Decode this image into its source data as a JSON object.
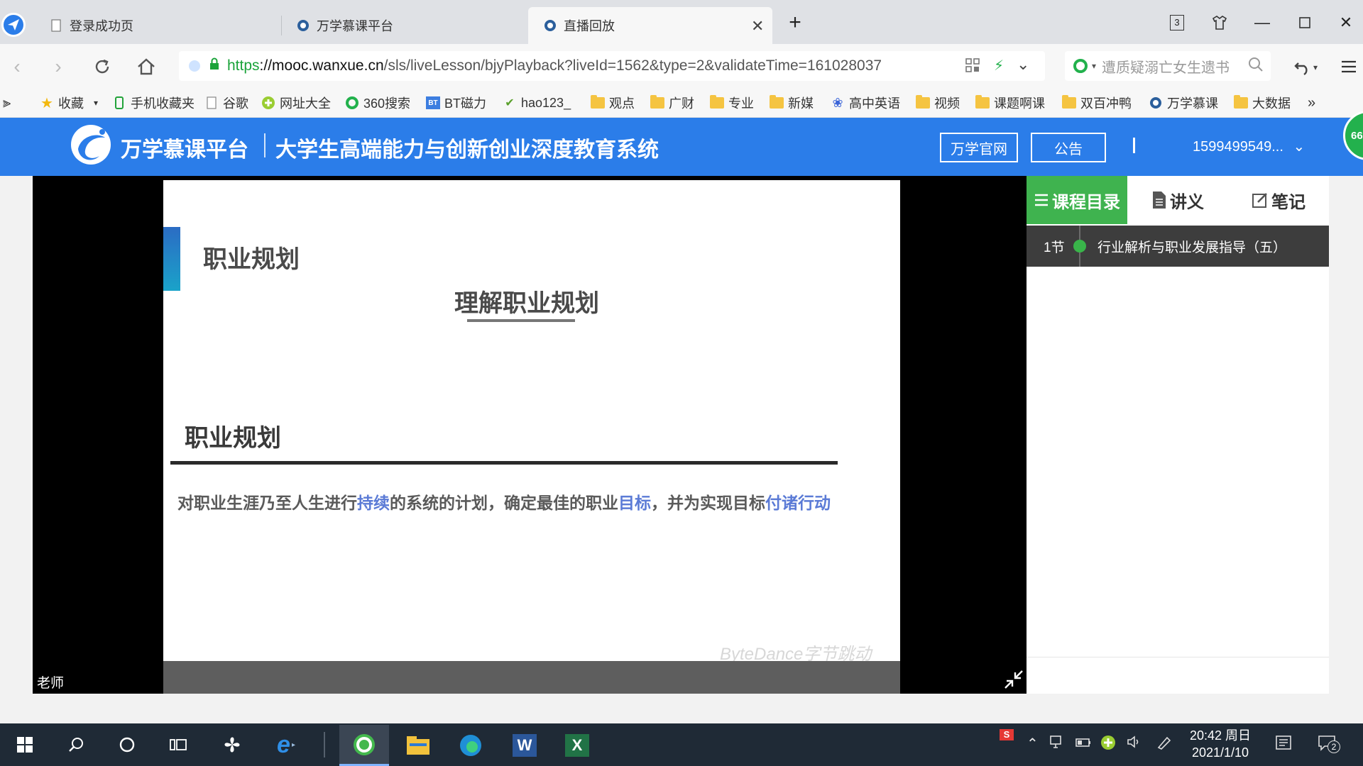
{
  "browser": {
    "tabs": [
      {
        "label": "登录成功页"
      },
      {
        "label": "万学慕课平台"
      },
      {
        "label": "直播回放"
      }
    ],
    "tab_counter": "3",
    "url_scheme": "https",
    "url_host": "://mooc.wanxue.cn",
    "url_path": "/sls/liveLesson/bjyPlayback?liveId=1562&type=2&validateTime=161028037",
    "search_placeholder": "遭质疑溺亡女生遗书",
    "bookmarks": [
      {
        "label": "收藏"
      },
      {
        "label": "手机收藏夹"
      },
      {
        "label": "谷歌"
      },
      {
        "label": "网址大全"
      },
      {
        "label": "360搜索"
      },
      {
        "label": "BT磁力"
      },
      {
        "label": "hao123_"
      },
      {
        "label": "观点"
      },
      {
        "label": "广财"
      },
      {
        "label": "专业"
      },
      {
        "label": "新媒"
      },
      {
        "label": "高中英语"
      },
      {
        "label": "视频"
      },
      {
        "label": "课题啊课"
      },
      {
        "label": "双百冲鸭"
      },
      {
        "label": "万学慕课"
      },
      {
        "label": "大数据"
      }
    ],
    "bookmarks_more": "»"
  },
  "site": {
    "title": "万学慕课平台",
    "slogan": "大学生高端能力与创新创业深度教育系统",
    "official_btn": "万学官网",
    "notice_btn": "公告",
    "username": "1599499549...",
    "badge": "66"
  },
  "video": {
    "slide": {
      "heading_small": "职业规划",
      "heading_center": "理解职业规划",
      "section_title": "职业规划",
      "body_a": "对职业生涯乃至人生进行",
      "body_hl1": "持续",
      "body_b": "的系统的计划，确定最佳的职业",
      "body_hl2": "目标",
      "body_c": "，并为实现目标",
      "body_hl3": "付诸行动",
      "watermark": "ByteDance字节跳动"
    },
    "speaker_label": "老师"
  },
  "sidebar": {
    "tabs": [
      {
        "label": "课程目录"
      },
      {
        "label": "讲义"
      },
      {
        "label": "笔记"
      }
    ],
    "lessons": [
      {
        "num": "1节",
        "title": "行业解析与职业发展指导（五）"
      }
    ]
  },
  "taskbar": {
    "time": "20:42 周日",
    "date": "2021/1/10",
    "notif_count": "2"
  }
}
